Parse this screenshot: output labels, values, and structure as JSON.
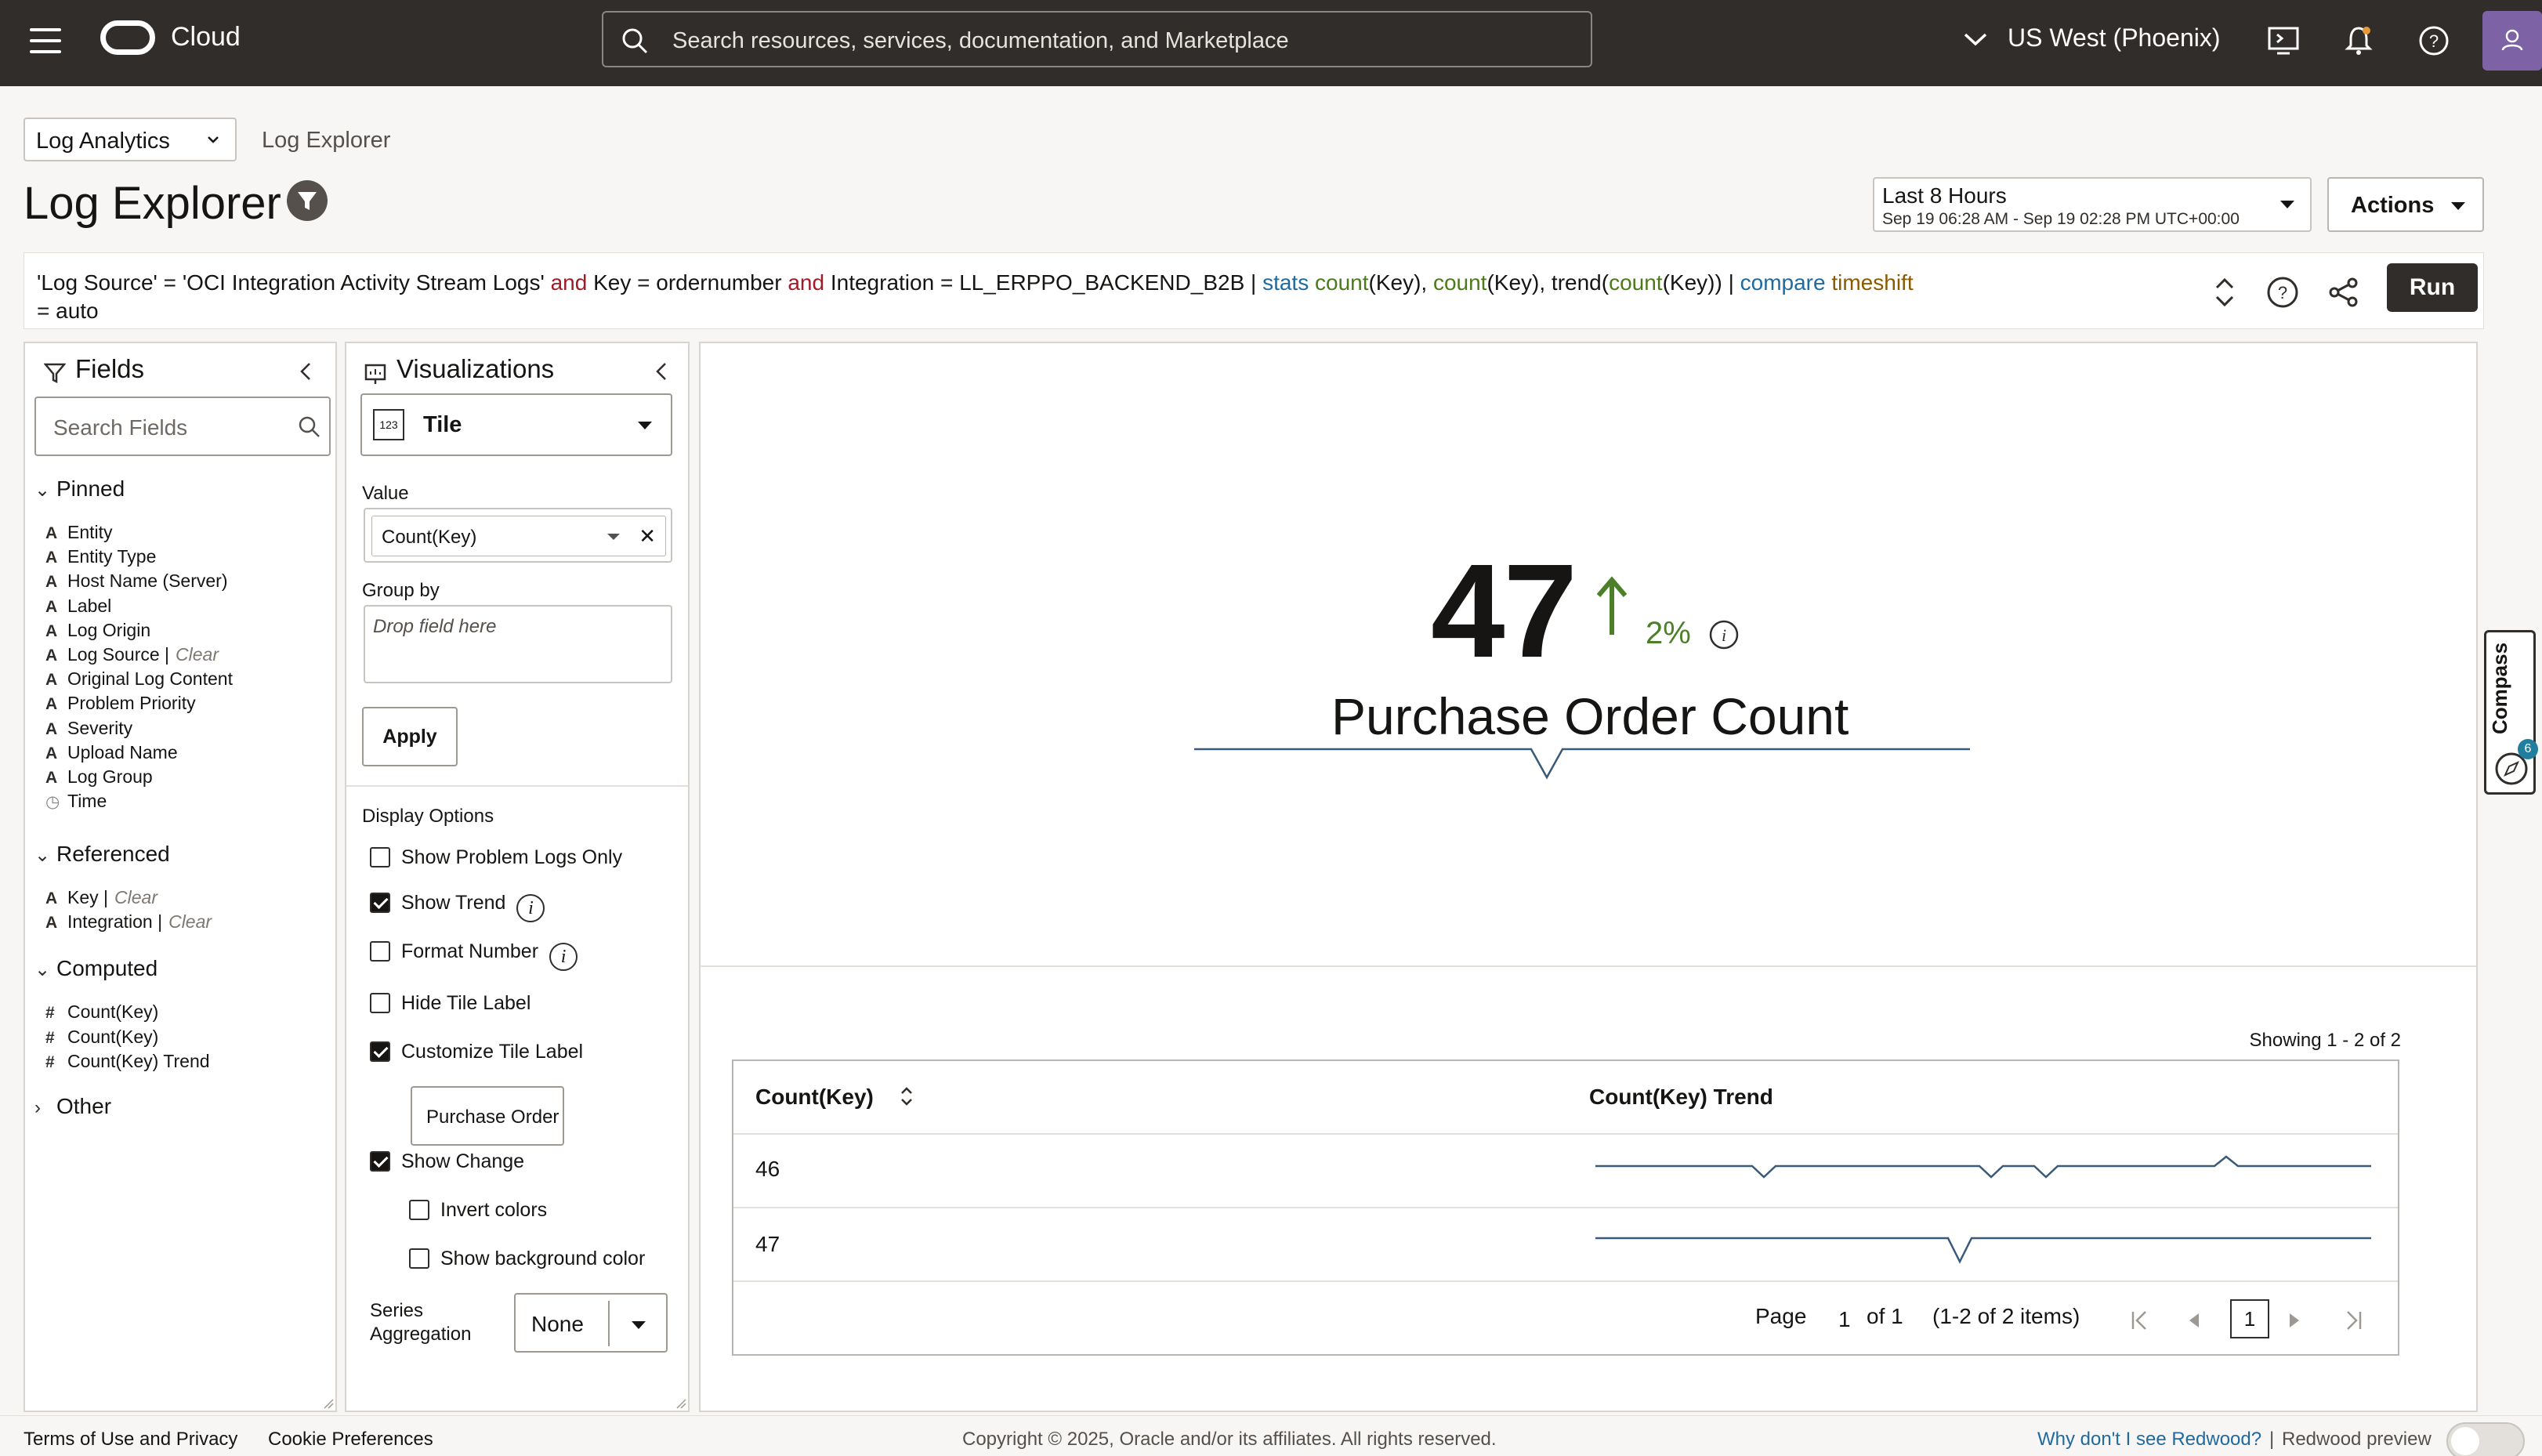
{
  "topbar": {
    "brand": "Cloud",
    "search_placeholder": "Search resources, services, documentation, and Marketplace",
    "region": "US West (Phoenix)"
  },
  "header": {
    "app_select": "Log Analytics",
    "breadcrumb": "Log Explorer",
    "title": "Log Explorer",
    "time_range_label": "Last 8 Hours",
    "time_range_detail": "Sep 19 06:28 AM - Sep 19 02:28 PM UTC+00:00",
    "actions_label": "Actions"
  },
  "query": {
    "p1": "'Log Source' = 'OCI Integration Activity Stream Logs' ",
    "and1": "and",
    "p2": " Key = ordernumber ",
    "and2": "and",
    "p3": " Integration = LL_ERPPO_BACKEND_B2B | ",
    "stats": "stats",
    "p4": " ",
    "count1": "count",
    "p5": "(Key), ",
    "count2": "count",
    "p6": "(Key), trend(",
    "count3": "count",
    "p7": "(Key)) | ",
    "compare": "compare",
    "p8": " ",
    "timeshift": "timeshift",
    "p9": "= auto",
    "run_label": "Run"
  },
  "fields_panel": {
    "title": "Fields",
    "search_placeholder": "Search Fields",
    "pinned_label": "Pinned",
    "pinned": [
      {
        "type": "A",
        "name": "Entity"
      },
      {
        "type": "A",
        "name": "Entity Type"
      },
      {
        "type": "A",
        "name": "Host Name (Server)"
      },
      {
        "type": "A",
        "name": "Label"
      },
      {
        "type": "A",
        "name": "Log Origin"
      },
      {
        "type": "A",
        "name": "Log Source",
        "clear": "Clear"
      },
      {
        "type": "A",
        "name": "Original Log Content"
      },
      {
        "type": "A",
        "name": "Problem Priority"
      },
      {
        "type": "A",
        "name": "Severity"
      },
      {
        "type": "A",
        "name": "Upload Name"
      },
      {
        "type": "A",
        "name": "Log Group"
      },
      {
        "type": "◷",
        "name": "Time"
      }
    ],
    "referenced_label": "Referenced",
    "referenced": [
      {
        "type": "A",
        "name": "Key",
        "clear": "Clear"
      },
      {
        "type": "A",
        "name": "Integration",
        "clear": "Clear"
      }
    ],
    "computed_label": "Computed",
    "computed": [
      {
        "type": "#",
        "name": "Count(Key)"
      },
      {
        "type": "#",
        "name": "Count(Key)"
      },
      {
        "type": "#",
        "name": "Count(Key) Trend"
      }
    ],
    "other_label": "Other"
  },
  "viz_panel": {
    "title": "Visualizations",
    "viz_icon_text": "123",
    "viz_type": "Tile",
    "value_label": "Value",
    "value_field": "Count(Key)",
    "group_by_label": "Group by",
    "group_by_placeholder": "Drop field here",
    "apply_label": "Apply",
    "display_options_label": "Display Options",
    "options": {
      "show_problem_logs": {
        "label": "Show Problem Logs Only",
        "checked": false
      },
      "show_trend": {
        "label": "Show Trend",
        "checked": true
      },
      "format_number": {
        "label": "Format Number",
        "checked": false
      },
      "hide_tile_label": {
        "label": "Hide Tile Label",
        "checked": false
      },
      "customize_tile_label": {
        "label": "Customize Tile Label",
        "checked": true
      },
      "show_change": {
        "label": "Show Change",
        "checked": true
      },
      "invert_colors": {
        "label": "Invert colors",
        "checked": false
      },
      "show_bg_color": {
        "label": "Show background color",
        "checked": false
      }
    },
    "tile_label_value": "Purchase Order Co",
    "series_aggregation_label_1": "Series",
    "series_aggregation_label_2": "Aggregation",
    "series_aggregation_value": "None"
  },
  "tile": {
    "value": "47",
    "change_pct": "2%",
    "label": "Purchase Order Count",
    "accent_color": "#4b7f28"
  },
  "table": {
    "showing": "Showing 1 - 2 of 2",
    "col1": "Count(Key)",
    "col2": "Count(Key) Trend",
    "rows": [
      {
        "count": "46"
      },
      {
        "count": "47"
      }
    ],
    "page_label": "Page",
    "page_num": "1",
    "of_pages": "of 1",
    "items": "(1-2 of 2 items)",
    "current_page": "1"
  },
  "compass": {
    "label": "Compass",
    "badge": "6"
  },
  "footer": {
    "terms": "Terms of Use and Privacy",
    "cookies": "Cookie Preferences",
    "copyright": "Copyright © 2025, Oracle and/or its affiliates. All rights reserved.",
    "redwood_link": "Why don't I see Redwood?",
    "redwood_sep": "|",
    "redwood_preview": "Redwood preview"
  }
}
